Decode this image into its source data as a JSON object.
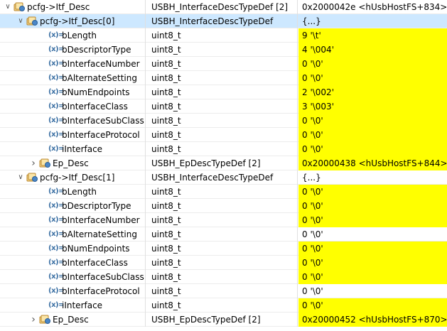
{
  "icons": {
    "struct": "struct-variable-icon",
    "field": "field-variable-icon",
    "expanded": "chevron-down-icon",
    "collapsed": "chevron-right-icon"
  },
  "colors": {
    "changed_value": "#ffff00",
    "selected_row": "#cde8ff"
  },
  "rows": [
    {
      "level": 0,
      "kind": "struct",
      "expand": "open",
      "name": "pcfg->Itf_Desc",
      "type": "USBH_InterfaceDescTypeDef [2]",
      "value": "0x2000042e <hUsbHostFS+834>",
      "changed": false,
      "selected": false
    },
    {
      "level": 1,
      "kind": "struct",
      "expand": "open",
      "name": "pcfg->Itf_Desc[0]",
      "type": "USBH_InterfaceDescTypeDef",
      "value": "{...}",
      "changed": false,
      "selected": true
    },
    {
      "level": 2,
      "kind": "field",
      "expand": "none",
      "name": "bLength",
      "type": "uint8_t",
      "value": "9 '\\t'",
      "changed": true,
      "selected": false
    },
    {
      "level": 2,
      "kind": "field",
      "expand": "none",
      "name": "bDescriptorType",
      "type": "uint8_t",
      "value": "4 '\\004'",
      "changed": true,
      "selected": false
    },
    {
      "level": 2,
      "kind": "field",
      "expand": "none",
      "name": "bInterfaceNumber",
      "type": "uint8_t",
      "value": "0 '\\0'",
      "changed": true,
      "selected": false
    },
    {
      "level": 2,
      "kind": "field",
      "expand": "none",
      "name": "bAlternateSetting",
      "type": "uint8_t",
      "value": "0 '\\0'",
      "changed": true,
      "selected": false
    },
    {
      "level": 2,
      "kind": "field",
      "expand": "none",
      "name": "bNumEndpoints",
      "type": "uint8_t",
      "value": "2 '\\002'",
      "changed": true,
      "selected": false
    },
    {
      "level": 2,
      "kind": "field",
      "expand": "none",
      "name": "bInterfaceClass",
      "type": "uint8_t",
      "value": "3 '\\003'",
      "changed": true,
      "selected": false
    },
    {
      "level": 2,
      "kind": "field",
      "expand": "none",
      "name": "bInterfaceSubClass",
      "type": "uint8_t",
      "value": "0 '\\0'",
      "changed": true,
      "selected": false
    },
    {
      "level": 2,
      "kind": "field",
      "expand": "none",
      "name": "bInterfaceProtocol",
      "type": "uint8_t",
      "value": "0 '\\0'",
      "changed": true,
      "selected": false
    },
    {
      "level": 2,
      "kind": "field",
      "expand": "none",
      "name": "iInterface",
      "type": "uint8_t",
      "value": "0 '\\0'",
      "changed": true,
      "selected": false
    },
    {
      "level": 2,
      "kind": "struct",
      "expand": "closed",
      "name": "Ep_Desc",
      "type": "USBH_EpDescTypeDef [2]",
      "value": "0x20000438 <hUsbHostFS+844>",
      "changed": true,
      "selected": false
    },
    {
      "level": 1,
      "kind": "struct",
      "expand": "open",
      "name": "pcfg->Itf_Desc[1]",
      "type": "USBH_InterfaceDescTypeDef",
      "value": "{...}",
      "changed": false,
      "selected": false
    },
    {
      "level": 2,
      "kind": "field",
      "expand": "none",
      "name": "bLength",
      "type": "uint8_t",
      "value": "0 '\\0'",
      "changed": true,
      "selected": false
    },
    {
      "level": 2,
      "kind": "field",
      "expand": "none",
      "name": "bDescriptorType",
      "type": "uint8_t",
      "value": "0 '\\0'",
      "changed": true,
      "selected": false
    },
    {
      "level": 2,
      "kind": "field",
      "expand": "none",
      "name": "bInterfaceNumber",
      "type": "uint8_t",
      "value": "0 '\\0'",
      "changed": true,
      "selected": false
    },
    {
      "level": 2,
      "kind": "field",
      "expand": "none",
      "name": "bAlternateSetting",
      "type": "uint8_t",
      "value": "0 '\\0'",
      "changed": false,
      "selected": false
    },
    {
      "level": 2,
      "kind": "field",
      "expand": "none",
      "name": "bNumEndpoints",
      "type": "uint8_t",
      "value": "0 '\\0'",
      "changed": true,
      "selected": false
    },
    {
      "level": 2,
      "kind": "field",
      "expand": "none",
      "name": "bInterfaceClass",
      "type": "uint8_t",
      "value": "0 '\\0'",
      "changed": true,
      "selected": false
    },
    {
      "level": 2,
      "kind": "field",
      "expand": "none",
      "name": "bInterfaceSubClass",
      "type": "uint8_t",
      "value": "0 '\\0'",
      "changed": true,
      "selected": false
    },
    {
      "level": 2,
      "kind": "field",
      "expand": "none",
      "name": "bInterfaceProtocol",
      "type": "uint8_t",
      "value": "0 '\\0'",
      "changed": false,
      "selected": false
    },
    {
      "level": 2,
      "kind": "field",
      "expand": "none",
      "name": "iInterface",
      "type": "uint8_t",
      "value": "0 '\\0'",
      "changed": true,
      "selected": false
    },
    {
      "level": 2,
      "kind": "struct",
      "expand": "closed",
      "name": "Ep_Desc",
      "type": "USBH_EpDescTypeDef [2]",
      "value": "0x20000452 <hUsbHostFS+870>",
      "changed": true,
      "selected": false
    }
  ]
}
